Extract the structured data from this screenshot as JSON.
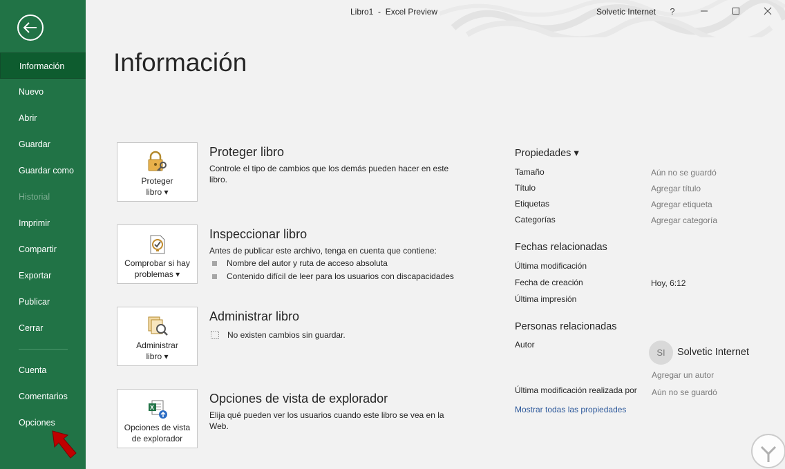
{
  "titlebar": {
    "title": "Libro1  -  Excel Preview",
    "user": "Solvetic Internet",
    "help": "?",
    "minimize_icon": "minimize-icon",
    "maximize_icon": "maximize-icon",
    "close_icon": "close-icon"
  },
  "sidebar": {
    "back_icon": "back-arrow-icon",
    "items": [
      {
        "label": "Información",
        "state": "active"
      },
      {
        "label": "Nuevo"
      },
      {
        "label": "Abrir"
      },
      {
        "label": "Guardar"
      },
      {
        "label": "Guardar como"
      },
      {
        "label": "Historial",
        "state": "disabled"
      },
      {
        "label": "Imprimir"
      },
      {
        "label": "Compartir"
      },
      {
        "label": "Exportar"
      },
      {
        "label": "Publicar"
      },
      {
        "label": "Cerrar"
      }
    ],
    "bottom_items": [
      {
        "label": "Cuenta"
      },
      {
        "label": "Comentarios"
      },
      {
        "label": "Opciones"
      }
    ]
  },
  "main": {
    "page_title": "Información",
    "sections": [
      {
        "button_label_1": "Proteger",
        "button_label_2": "libro ▾",
        "icon": "lock-key-icon",
        "title": "Proteger libro",
        "desc": "Controle el tipo de cambios que los demás pueden hacer en este libro."
      },
      {
        "button_label_1": "Comprobar si hay",
        "button_label_2": "problemas ▾",
        "icon": "inspect-document-icon",
        "title": "Inspeccionar libro",
        "desc": "Antes de publicar este archivo, tenga en cuenta que contiene:",
        "bullets": [
          "Nombre del autor y ruta de acceso absoluta",
          "Contenido difícil de leer para los usuarios con discapacidades"
        ]
      },
      {
        "button_label_1": "Administrar",
        "button_label_2": "libro ▾",
        "icon": "manage-workbook-icon",
        "title": "Administrar libro",
        "desc": "No existen cambios sin guardar."
      },
      {
        "button_label_1": "Opciones de vista",
        "button_label_2": "de explorador",
        "icon": "browser-view-options-icon",
        "title": "Opciones de vista de explorador",
        "desc": "Elija qué pueden ver los usuarios cuando este libro se vea en la Web."
      }
    ]
  },
  "properties": {
    "title": "Propiedades ▾",
    "rows": [
      {
        "label": "Tamaño",
        "value": "Aún no se guardó"
      },
      {
        "label": "Título",
        "value": "Agregar título"
      },
      {
        "label": "Etiquetas",
        "value": "Agregar etiqueta"
      },
      {
        "label": "Categorías",
        "value": "Agregar categoría"
      }
    ],
    "dates_title": "Fechas relacionadas",
    "dates": [
      {
        "label": "Última modificación",
        "value": ""
      },
      {
        "label": "Fecha de creación",
        "value": "Hoy, 6:12"
      },
      {
        "label": "Última impresión",
        "value": ""
      }
    ],
    "people_title": "Personas relacionadas",
    "author_label": "Autor",
    "author_initials": "SI",
    "author_name": "Solvetic Internet",
    "add_author": "Agregar un autor",
    "last_modified_by_label": "Última modificación realizada por",
    "last_modified_by_value": "Aún no se guardó",
    "show_all_link": "Mostrar todas las propiedades"
  },
  "colors": {
    "sidebar": "#217346",
    "sidebar_active": "#0e5c2f",
    "link": "#2b579a",
    "annotation_arrow": "#c00000"
  }
}
